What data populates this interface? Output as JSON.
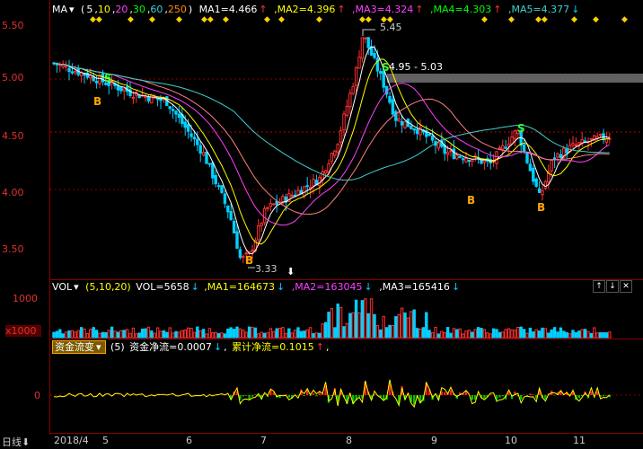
{
  "main_header": {
    "ind_name": "MA",
    "params_prefix": "(",
    "p1": "5",
    "p2": "10",
    "p3": "20",
    "p4": "30",
    "p5": "60",
    "p6": "250",
    "params_suffix": ")",
    "ma1": "MA1=4.466",
    "ma2": "MA2=4.396",
    "ma3": "MA3=4.324",
    "ma4": "MA4=4.303",
    "ma5": "MA5=4.377",
    "arrow_up": "↑",
    "arrow_down": "↓"
  },
  "vol_header": {
    "ind_name": "VOL",
    "params": "(5,10,20)",
    "vol": "VOL=5658",
    "ma1": "MA1=164673",
    "ma2": "MA2=163045",
    "ma3": "MA3=165416",
    "arrow_down": "↓"
  },
  "fund_header": {
    "ind_name": "资金流变",
    "dropdown_icon": "▾",
    "param": "(5)",
    "net": "资金净流=0.0007",
    "cum": "累计净流=0.1015",
    "arrow_down": "↓",
    "arrow_up": "↑",
    "sep": ","
  },
  "y_axis": {
    "main": [
      "5.50",
      "5.00",
      "4.50",
      "4.00",
      "3.50"
    ],
    "vol": [
      "1000",
      "x1000"
    ],
    "fund": [
      "0"
    ]
  },
  "x_axis": {
    "period_label": "日线",
    "period_arrow": "⬇",
    "ticks": [
      "2018/4",
      "5",
      "6",
      "7",
      "8",
      "9",
      "10",
      "11"
    ]
  },
  "annotations": {
    "high": "5.45",
    "low": "3.33",
    "range_box": "4.95 - 5.03",
    "buy": "B",
    "sell": "S"
  },
  "colors": {
    "up": "#ff3030",
    "down": "#00d0ff",
    "ma1": "#ffffff",
    "ma2": "#ffff00",
    "ma3": "#ff40ff",
    "ma4": "#00ff00",
    "ma5": "#40d0d0",
    "grid": "#8b0000",
    "axis_text": "#e03030"
  },
  "controls": [
    "↑",
    "↓",
    "✕"
  ]
}
